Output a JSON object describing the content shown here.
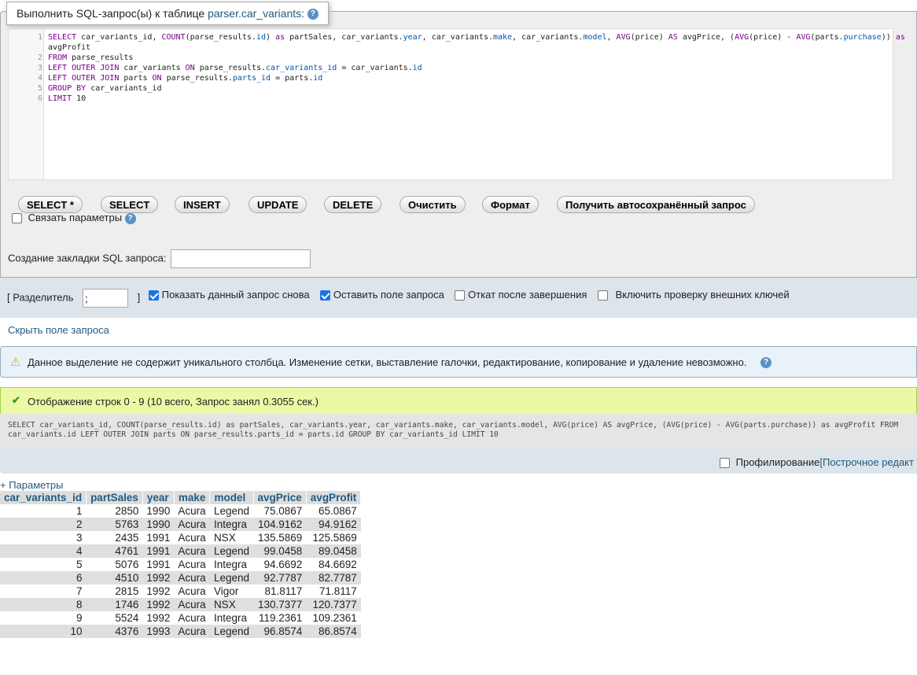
{
  "header": {
    "title_prefix": "Выполнить SQL-запрос(ы) к таблице",
    "table_name": "parser.car_variants:",
    "help_icon": "?"
  },
  "editor": {
    "lines": [
      {
        "n": "1",
        "text": "SELECT car_variants_id, COUNT(parse_results.id) as partSales, car_variants.year, car_variants.make, car_variants.model, AVG(price) AS avgPrice, (AVG(price) - AVG(parts.purchase)) as"
      },
      {
        "n": "",
        "text": "avgProfit"
      },
      {
        "n": "2",
        "text": "FROM parse_results"
      },
      {
        "n": "3",
        "text": "LEFT OUTER JOIN car_variants ON parse_results.car_variants_id = car_variants.id"
      },
      {
        "n": "4",
        "text": "LEFT OUTER JOIN parts ON parse_results.parts_id = parts.id"
      },
      {
        "n": "5",
        "text": "GROUP BY car_variants_id"
      },
      {
        "n": "6",
        "text": "LIMIT 10"
      }
    ]
  },
  "buttons": {
    "select_star": "SELECT *",
    "select": "SELECT",
    "insert": "INSERT",
    "update": "UPDATE",
    "delete": "DELETE",
    "clear": "Очистить",
    "format": "Формат",
    "autosave": "Получить автосохранённый запрос"
  },
  "bind_params": "Связать параметры",
  "bookmark_label": "Создание закладки SQL запроса:",
  "bookmark_value": "",
  "options": {
    "delimiter_label": "[ Разделитель",
    "delimiter_value": ";",
    "delimiter_close": "]",
    "show_again": "Показать данный запрос снова",
    "show_again_checked": true,
    "keep_box": "Оставить поле запроса",
    "keep_box_checked": true,
    "rollback": "Откат после завершения",
    "rollback_checked": false,
    "fk_check": "Включить проверку внешних ключей",
    "fk_check_checked": false
  },
  "hide_query": "Скрыть поле запроса",
  "notice": "Данное выделение не содержит уникального столбца. Изменение сетки, выставление галочки, редактирование, копирование и удаление невозможно.",
  "success": "Отображение строк 0 - 9 (10 всего, Запрос занял 0.3055 сек.)",
  "executed_sql": "SELECT car_variants_id, COUNT(parse_results.id) as partSales, car_variants.year, car_variants.make, car_variants.model, AVG(price) AS avgPrice, (AVG(price) - AVG(parts.purchase)) as avgProfit FROM\ncar_variants.id LEFT OUTER JOIN parts ON parse_results.parts_id = parts.id GROUP BY car_variants_id LIMIT 10",
  "profiling": "Профилирование",
  "inline_edit": "[Построчное редакт",
  "params_link": "+ Параметры",
  "results": {
    "columns": [
      "car_variants_id",
      "partSales",
      "year",
      "make",
      "model",
      "avgPrice",
      "avgProfit"
    ],
    "rows": [
      [
        "1",
        "2850",
        "1990",
        "Acura",
        "Legend",
        "75.0867",
        "65.0867"
      ],
      [
        "2",
        "5763",
        "1990",
        "Acura",
        "Integra",
        "104.9162",
        "94.9162"
      ],
      [
        "3",
        "2435",
        "1991",
        "Acura",
        "NSX",
        "135.5869",
        "125.5869"
      ],
      [
        "4",
        "4761",
        "1991",
        "Acura",
        "Legend",
        "99.0458",
        "89.0458"
      ],
      [
        "5",
        "5076",
        "1991",
        "Acura",
        "Integra",
        "94.6692",
        "84.6692"
      ],
      [
        "6",
        "4510",
        "1992",
        "Acura",
        "Legend",
        "92.7787",
        "82.7787"
      ],
      [
        "7",
        "2815",
        "1992",
        "Acura",
        "Vigor",
        "81.8117",
        "71.8117"
      ],
      [
        "8",
        "1746",
        "1992",
        "Acura",
        "NSX",
        "130.7377",
        "120.7377"
      ],
      [
        "9",
        "5524",
        "1992",
        "Acura",
        "Integra",
        "119.2361",
        "109.2361"
      ],
      [
        "10",
        "4376",
        "1993",
        "Acura",
        "Legend",
        "96.8574",
        "86.8574"
      ]
    ]
  }
}
